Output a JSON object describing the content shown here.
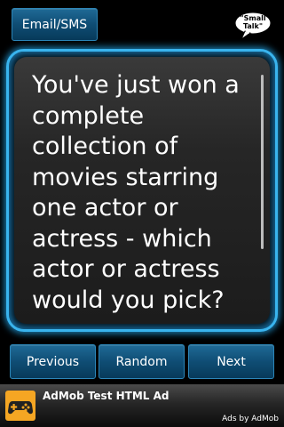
{
  "header": {
    "email_sms_label": "Email/SMS",
    "logo_text": "\"Small Talk\"",
    "logo_icon": "speech-bubble-icon"
  },
  "question": {
    "text": "You've just won a complete collection of movies starring one actor or actress - which actor or actress would you pick?"
  },
  "nav": {
    "previous_label": "Previous",
    "random_label": "Random",
    "next_label": "Next"
  },
  "ad": {
    "title": "AdMob Test HTML Ad",
    "credit": "Ads by AdMob",
    "icon": "gamepad-icon"
  },
  "colors": {
    "accent": "#39b4ee",
    "button_bg": "#0f4d74",
    "ad_icon_bg": "#f5a623"
  }
}
